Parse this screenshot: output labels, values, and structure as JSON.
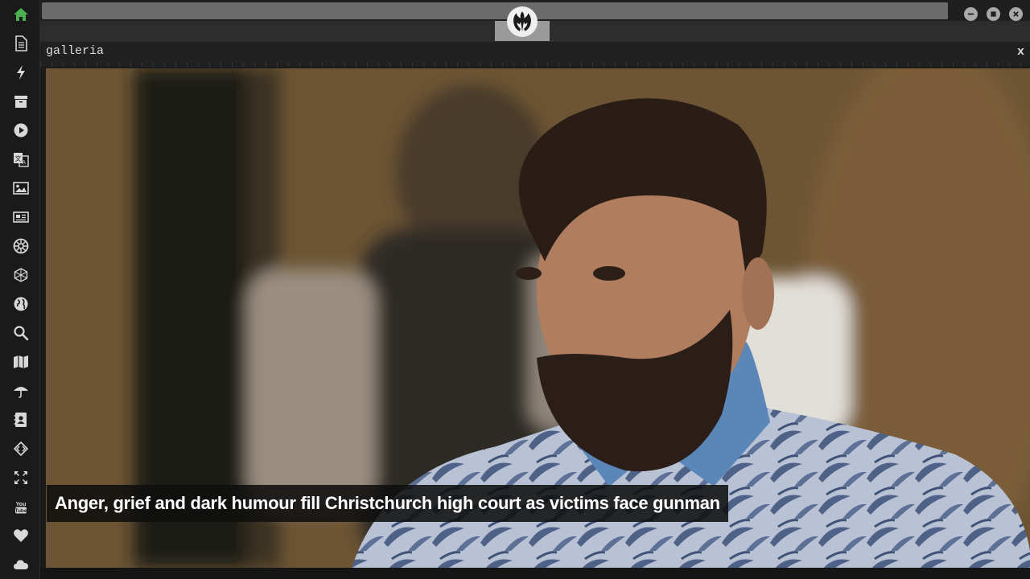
{
  "sidebar": {
    "items": [
      {
        "name": "home-icon",
        "active": true
      },
      {
        "name": "document-icon"
      },
      {
        "name": "lightning-icon"
      },
      {
        "name": "archive-icon"
      },
      {
        "name": "play-icon"
      },
      {
        "name": "translate-icon"
      },
      {
        "name": "image-icon"
      },
      {
        "name": "newspaper-icon"
      },
      {
        "name": "empire-icon"
      },
      {
        "name": "hexagon-icon"
      },
      {
        "name": "globe-icon"
      },
      {
        "name": "search-icon"
      },
      {
        "name": "map-icon"
      },
      {
        "name": "umbrella-icon"
      },
      {
        "name": "contact-icon"
      },
      {
        "name": "code-icon"
      },
      {
        "name": "expand-icon"
      },
      {
        "name": "youtube-icon"
      },
      {
        "name": "heart-icon"
      },
      {
        "name": "cloud-icon"
      }
    ],
    "youtube_label": "You Tube"
  },
  "window": {
    "controls": [
      "minimize-icon",
      "maximize-icon",
      "close-icon"
    ]
  },
  "panel": {
    "title": "galleria",
    "close_label": "x"
  },
  "gallery": {
    "caption": "Anger, grief and dark humour fill Christchurch high court as victims face gunman"
  },
  "colors": {
    "accent_active": "#4caf50",
    "icon": "#d8d8d8",
    "background": "#1b1b1b"
  }
}
